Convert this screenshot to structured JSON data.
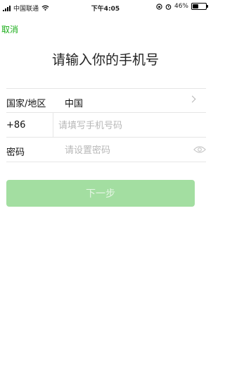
{
  "status_bar": {
    "carrier": "中国联通",
    "time": "下午4:05",
    "battery": "46%",
    "battery_level": 0.46
  },
  "nav": {
    "cancel_label": "取消"
  },
  "title": "请输入你的手机号",
  "form": {
    "country": {
      "label": "国家/地区",
      "value": "中国"
    },
    "phone": {
      "country_code": "+86",
      "placeholder": "请填写手机号码",
      "value": ""
    },
    "password": {
      "label": "密码",
      "placeholder": "请设置密码",
      "value": ""
    }
  },
  "next_button": {
    "label": "下一步",
    "enabled": false,
    "color": "#a3dea1"
  },
  "colors": {
    "accent": "#1aad19"
  }
}
